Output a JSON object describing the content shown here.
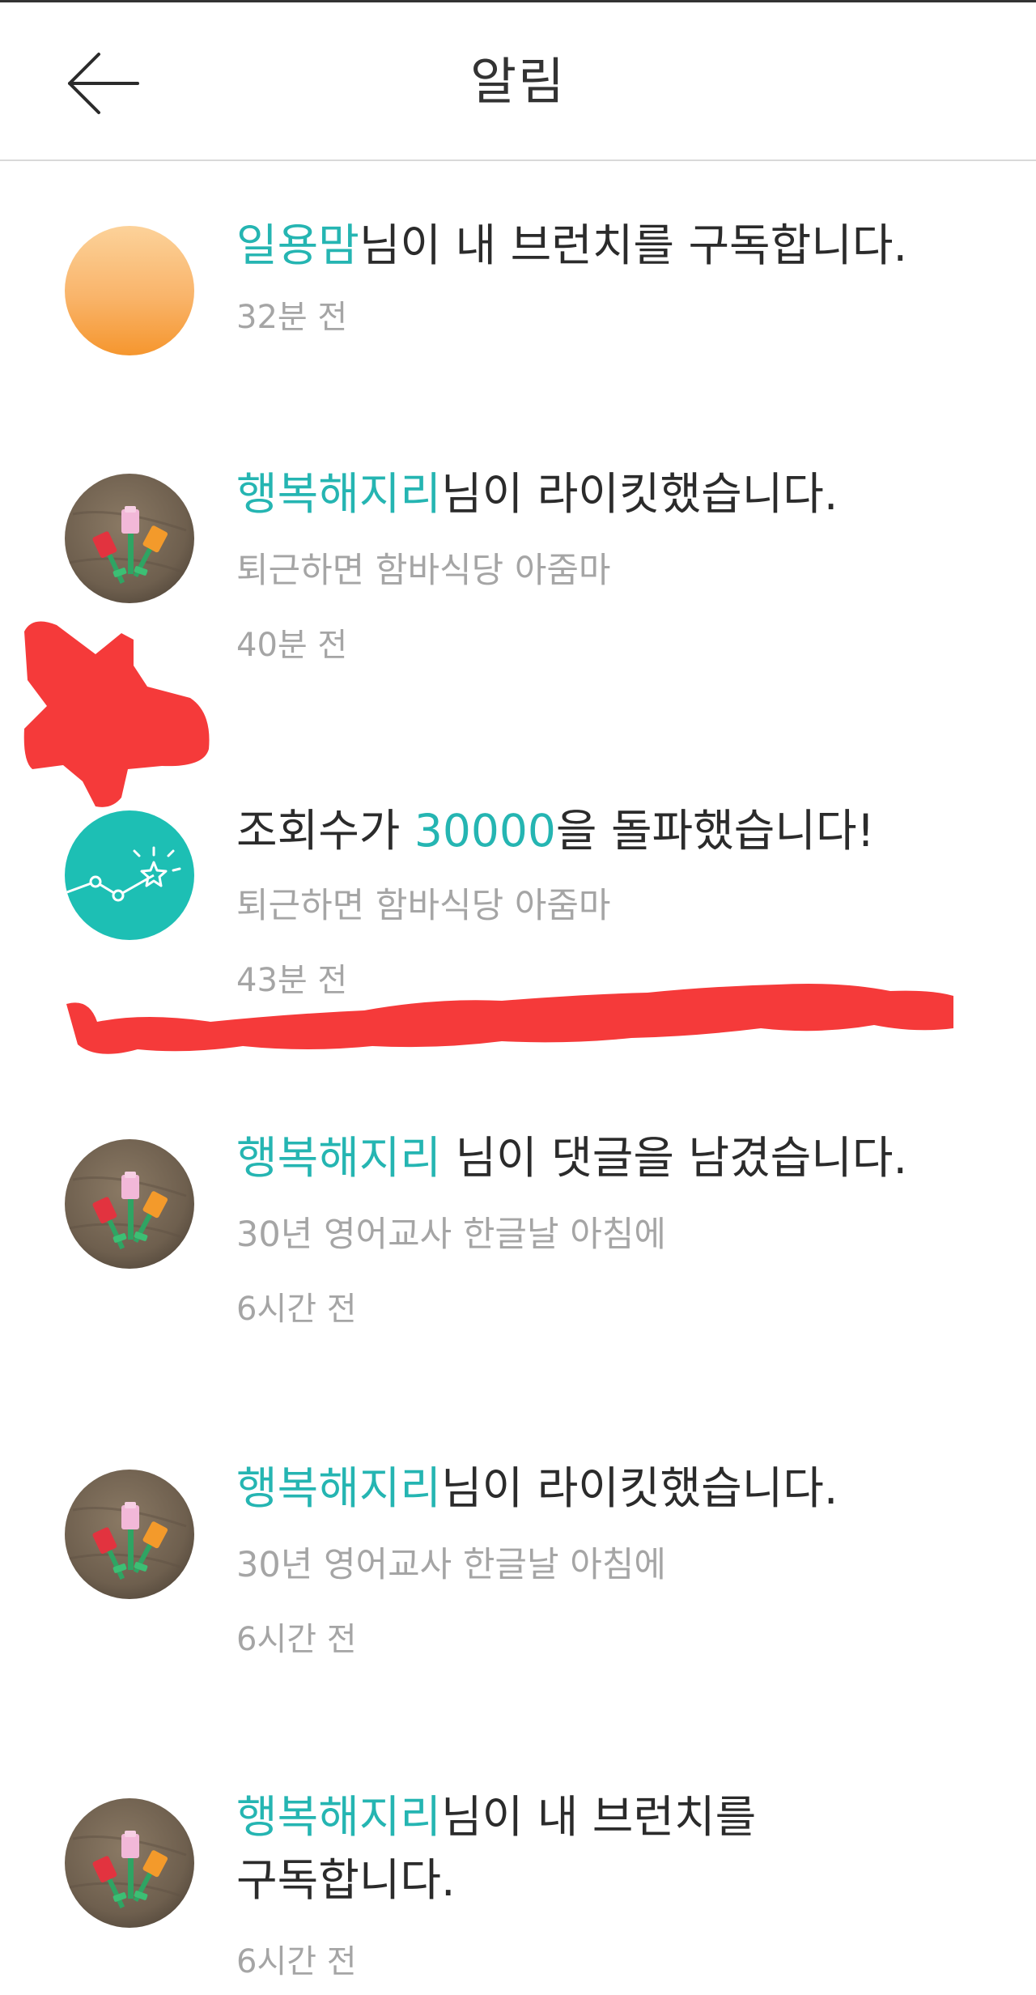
{
  "header": {
    "title": "알림",
    "back_icon": "arrow-left-icon"
  },
  "colors": {
    "accent": "#25b5b2",
    "secondary_text": "#a5a5a5",
    "primary_text": "#2b2b2b",
    "annotation": "#f53a3a"
  },
  "notifications": [
    {
      "avatar": "orange-gradient-avatar",
      "highlight": "일용맘",
      "text": "님이 내 브런치를 구독합니다.",
      "subtitle": "",
      "time": "32분 전"
    },
    {
      "avatar": "flower-photo-avatar",
      "highlight": "행복해지리",
      "text": "님이 라이킷했습니다.",
      "subtitle": "퇴근하면 함바식당 아줌마",
      "time": "40분 전"
    },
    {
      "avatar": "views-milestone-icon",
      "prefix": "조회수가 ",
      "highlight": "30000",
      "text": "을 돌파했습니다!",
      "subtitle": "퇴근하면 함바식당 아줌마",
      "time": "43분 전"
    },
    {
      "avatar": "flower-photo-avatar",
      "highlight": "행복해지리",
      "text": " 님이 댓글을 남겼습니다.",
      "subtitle": "30년 영어교사 한글날 아침에",
      "time": "6시간 전"
    },
    {
      "avatar": "flower-photo-avatar",
      "highlight": "행복해지리",
      "text": "님이 라이킷했습니다.",
      "subtitle": "30년 영어교사 한글날 아침에",
      "time": "6시간 전"
    },
    {
      "avatar": "flower-photo-avatar",
      "highlight": "행복해지리",
      "text": "님이 내 브런치를",
      "text_line2": "구독합니다.",
      "subtitle": "",
      "time": "6시간 전"
    }
  ]
}
